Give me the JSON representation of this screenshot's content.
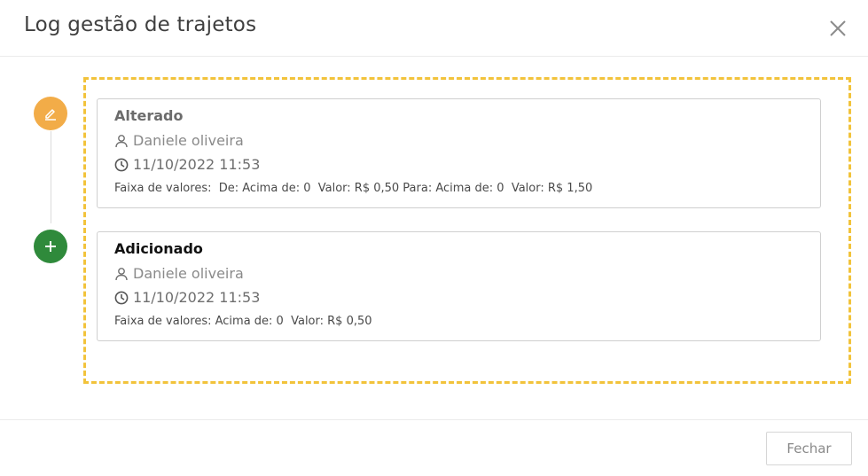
{
  "modal": {
    "title": "Log gestão de trajetos",
    "close_icon": "close-icon"
  },
  "colors": {
    "edit_accent": "#f2ac48",
    "add_accent": "#2f8a3b",
    "highlight_border": "#f2c33b"
  },
  "log_entries": [
    {
      "icon": "edit-icon",
      "title": "Alterado",
      "user": "Daniele oliveira",
      "timestamp": "11/10/2022 11:53",
      "details": "Faixa de valores:  De: Acima de: 0  Valor: R$ 0,50 Para: Acima de: 0  Valor: R$ 1,50"
    },
    {
      "icon": "plus-icon",
      "title": "Adicionado",
      "user": "Daniele oliveira",
      "timestamp": "11/10/2022 11:53",
      "details": "Faixa de valores: Acima de: 0  Valor: R$ 0,50"
    }
  ],
  "footer": {
    "close_label": "Fechar"
  }
}
